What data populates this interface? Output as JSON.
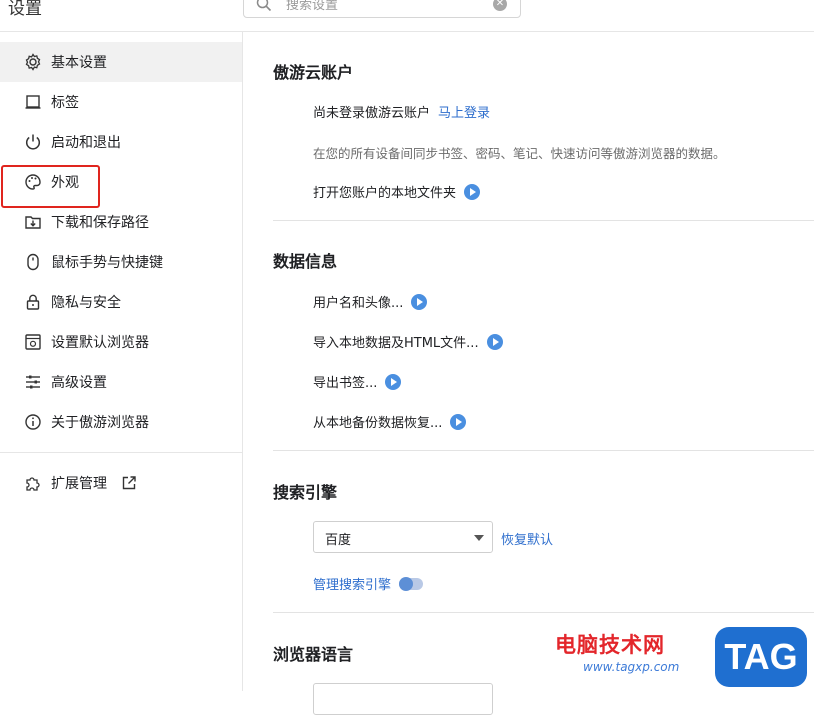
{
  "header": {
    "title": "设置",
    "search_placeholder": "搜索设置"
  },
  "sidebar": {
    "items": [
      {
        "label": "基本设置",
        "icon": "gear-icon",
        "active": true
      },
      {
        "label": "标签",
        "icon": "tab-icon"
      },
      {
        "label": "启动和退出",
        "icon": "power-icon"
      },
      {
        "label": "外观",
        "icon": "palette-icon"
      },
      {
        "label": "下载和保存路径",
        "icon": "download-icon"
      },
      {
        "label": "鼠标手势与快捷键",
        "icon": "mouse-icon"
      },
      {
        "label": "隐私与安全",
        "icon": "lock-icon"
      },
      {
        "label": "设置默认浏览器",
        "icon": "browser-icon"
      },
      {
        "label": "高级设置",
        "icon": "sliders-icon"
      },
      {
        "label": "关于傲游浏览器",
        "icon": "info-icon"
      }
    ],
    "extensions": {
      "label": "扩展管理",
      "icon": "puzzle-icon",
      "external_icon": "external-link-icon"
    }
  },
  "account": {
    "title": "傲游云账户",
    "not_logged": "尚未登录傲游云账户",
    "login_link": "马上登录",
    "description": "在您的所有设备间同步书签、密码、笔记、快速访问等傲游浏览器的数据。",
    "open_folder": "打开您账户的本地文件夹"
  },
  "data_info": {
    "title": "数据信息",
    "items": [
      "用户名和头像...",
      "导入本地数据及HTML文件...",
      "导出书签...",
      "从本地备份数据恢复..."
    ]
  },
  "search_engine": {
    "title": "搜索引擎",
    "selected": "百度",
    "restore": "恢复默认",
    "manage": "管理搜索引擎"
  },
  "language": {
    "title": "浏览器语言"
  },
  "watermark": {
    "text": "电脑技术网",
    "url": "www.tagxp.com",
    "badge": "TAG"
  },
  "colors": {
    "accent": "#2e6ecd",
    "highlight": "#e0251e",
    "arrow": "#4a8fe0"
  }
}
